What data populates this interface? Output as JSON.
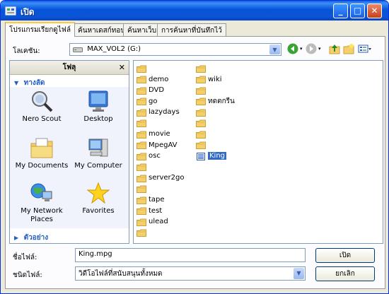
{
  "window": {
    "title": "เปิด",
    "controls": [
      "minimize-icon",
      "maximize-icon",
      "close-icon"
    ]
  },
  "tabs": [
    {
      "label": "โปรแกรมเรียกดูไฟล์",
      "active": true
    },
    {
      "label": "ค้นหาเดสก์ทอป",
      "active": false
    },
    {
      "label": "ค้นหาเว็บ",
      "active": false
    },
    {
      "label": "การค้นหาที่บันทึกไว้",
      "active": false
    }
  ],
  "location": {
    "label": "โลเคชัน:",
    "value": "MAX_VOL2 (G:)",
    "icon": "drive-icon"
  },
  "sidebar": {
    "title": "โฟลุ",
    "close": "✕",
    "places_header": "ทางลัด",
    "places": [
      {
        "label": "Nero Scout",
        "icon": "nero-scout-icon"
      },
      {
        "label": "Desktop",
        "icon": "desktop-icon"
      },
      {
        "label": "My Documents",
        "icon": "my-documents-icon"
      },
      {
        "label": "My Computer",
        "icon": "my-computer-icon"
      },
      {
        "label": "My Network Places",
        "icon": "network-places-icon"
      },
      {
        "label": "Favorites",
        "icon": "favorites-icon"
      }
    ],
    "preview_header": "ตัวอย่าง"
  },
  "files": {
    "column1": [
      "",
      "demo",
      "DVD",
      "go",
      "lazydays",
      "",
      "movie",
      "MpegAV",
      "osc",
      "",
      "server2go",
      "",
      "tape",
      "test",
      "ulead",
      ""
    ],
    "column2": [
      "",
      "wiki",
      "",
      "ทดตกรีน",
      "",
      "",
      "",
      "",
      "King"
    ],
    "selected": "King"
  },
  "filename": {
    "label": "ชื่อไฟล์:",
    "value": "King.mpg"
  },
  "filetype": {
    "label": "ชนิดไฟล์:",
    "value": "วิดีโอไฟล์ที่สนับสนุนทั้งหมด"
  },
  "buttons": {
    "open": "เปิด",
    "cancel": "ยกเลิก"
  },
  "colors": {
    "titlebar": "#0a55d6",
    "selection": "#316ac5",
    "folder": "#f5d06a",
    "tab_highlight": "#ffc83c"
  }
}
